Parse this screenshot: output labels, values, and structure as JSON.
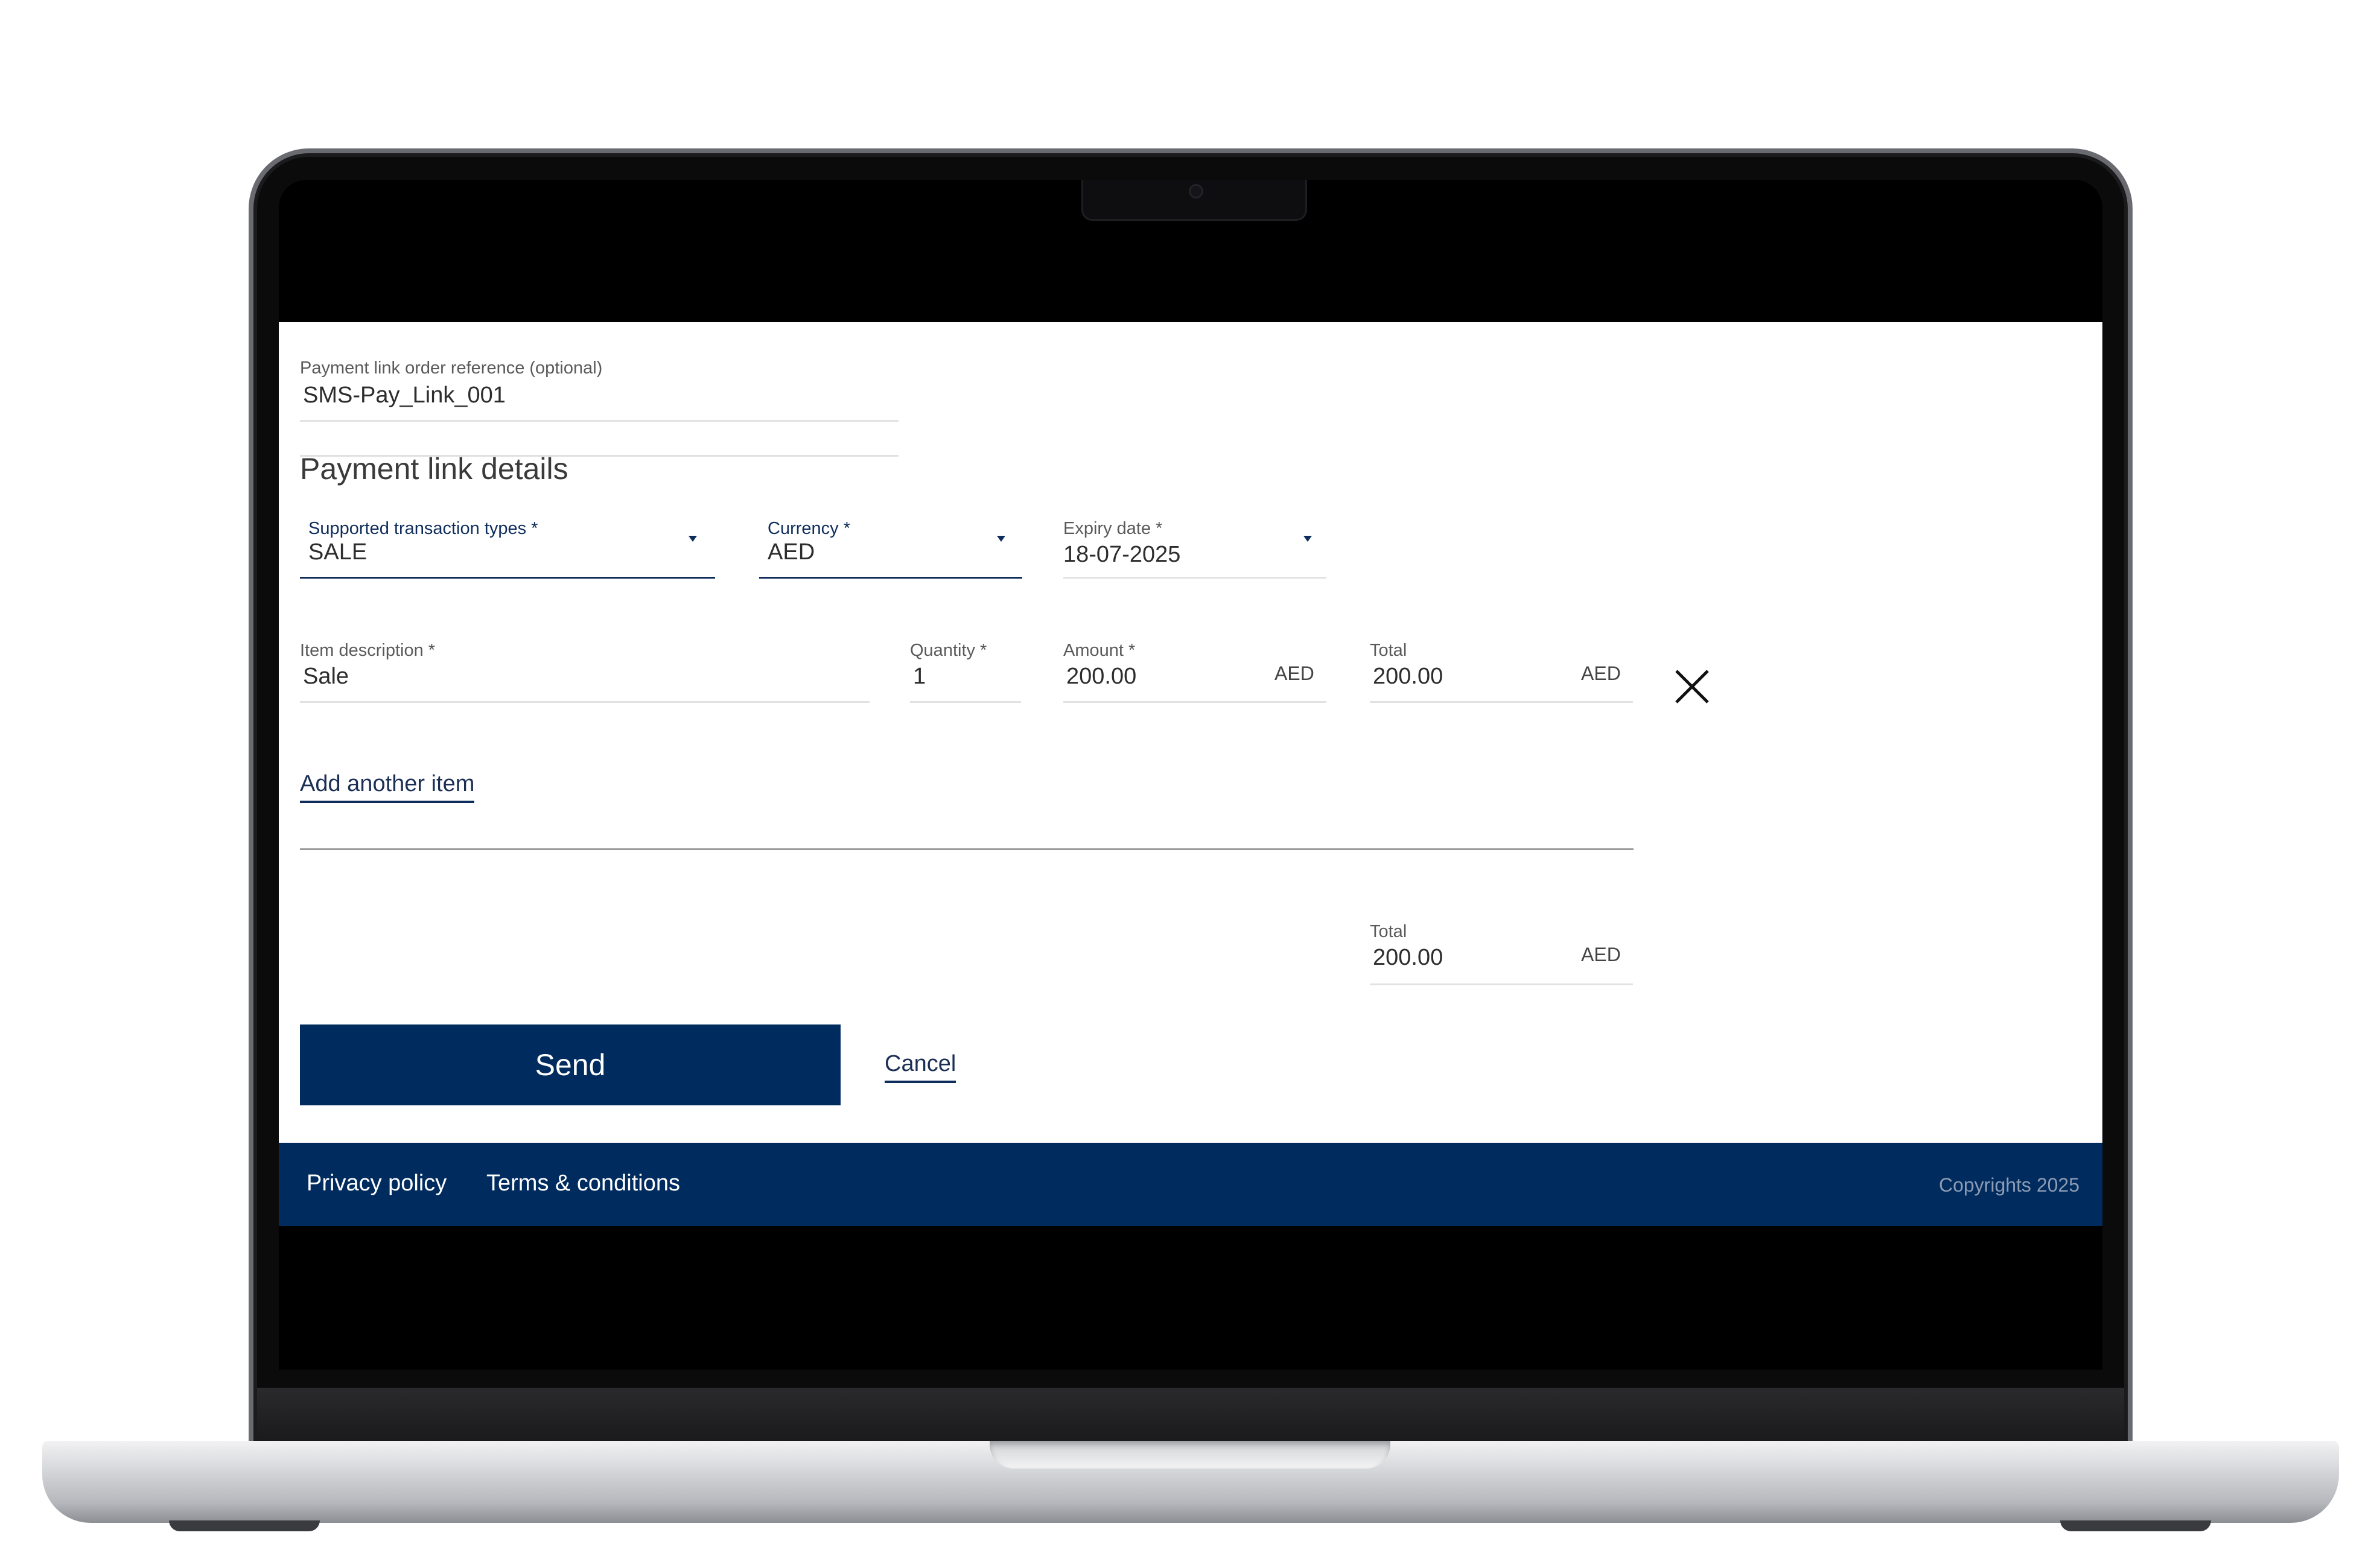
{
  "form": {
    "order_reference": {
      "label": "Payment link order reference (optional)",
      "value": "SMS-Pay_Link_001"
    },
    "section_title": "Payment link details",
    "transaction_types": {
      "label": "Supported transaction types *",
      "value": "SALE"
    },
    "currency": {
      "label": "Currency *",
      "value": "AED"
    },
    "expiry_date": {
      "label": "Expiry date *",
      "value": "18-07-2025"
    },
    "item": {
      "description_label": "Item description *",
      "description_value": "Sale",
      "quantity_label": "Quantity *",
      "quantity_value": "1",
      "amount_label": "Amount *",
      "amount_value": "200.00",
      "amount_unit": "AED",
      "total_label": "Total",
      "total_value": "200.00",
      "total_unit": "AED"
    },
    "add_item_label": "Add another item",
    "grand_total": {
      "label": "Total",
      "value": "200.00",
      "unit": "AED"
    },
    "send_label": "Send",
    "cancel_label": "Cancel"
  },
  "footer": {
    "privacy_label": "Privacy policy",
    "terms_label": "Terms & conditions",
    "copyright": "Copyrights 2025"
  },
  "colors": {
    "brand_navy": "#002b5e",
    "accent_navy": "#0f2d5c"
  },
  "icons": {
    "remove_item": "close-icon",
    "dropdown": "caret-down-icon"
  }
}
